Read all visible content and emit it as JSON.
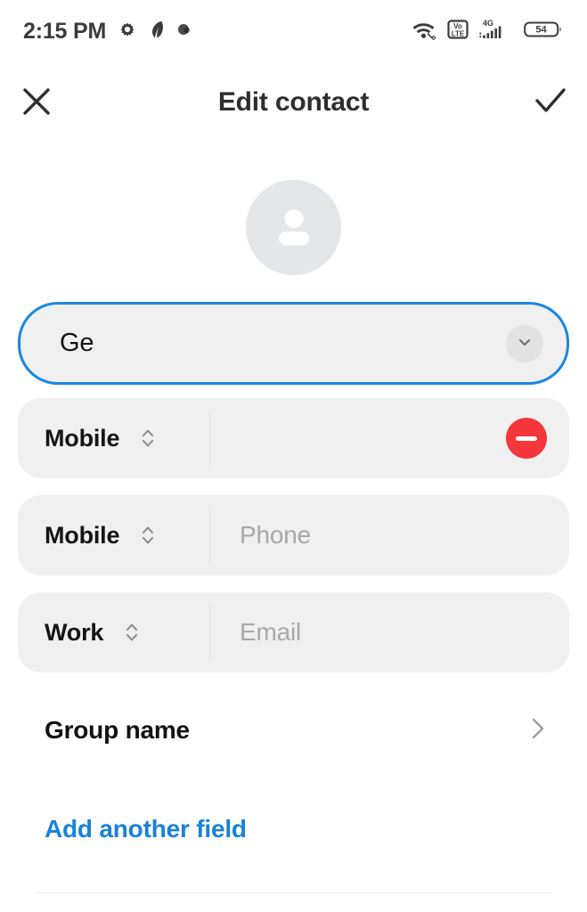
{
  "statusbar": {
    "time": "2:15 PM",
    "left_icons": [
      "gear-icon",
      "feather-icon",
      "circle-icon"
    ],
    "right_icons": [
      "wifi-icon",
      "volte-icon",
      "signal-4g-icon",
      "battery-icon"
    ],
    "volte_top": "Vo",
    "volte_bottom": "LTE",
    "network_type": "4G",
    "battery_level": "54"
  },
  "header": {
    "close_label": "close-icon",
    "title": "Edit contact",
    "save_label": "check-icon"
  },
  "avatar": {
    "name": "contact-photo-placeholder"
  },
  "name_field": {
    "value": "Ge",
    "expand_icon": "chevron-down-icon",
    "focused": true,
    "focus_color": "#1a87e5"
  },
  "rows": [
    {
      "type": "Mobile",
      "value": "",
      "placeholder": "",
      "has_remove": true
    },
    {
      "type": "Mobile",
      "value": "",
      "placeholder": "Phone",
      "has_remove": false
    },
    {
      "type": "Work",
      "value": "",
      "placeholder": "Email",
      "has_remove": false
    }
  ],
  "group": {
    "label": "Group name",
    "chevron": "chevron-right-icon"
  },
  "add_field": {
    "label": "Add another field",
    "color": "#1a82d8"
  },
  "colors": {
    "field_bg": "#f0f0f0",
    "remove_red": "#f5373c",
    "link_blue": "#1a82d8",
    "focus_blue": "#1a87e5",
    "avatar_bg": "#e4e6e9"
  }
}
